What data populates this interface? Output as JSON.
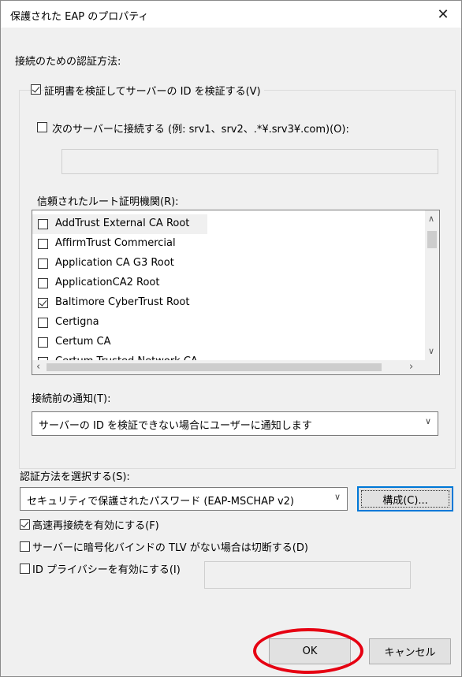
{
  "dialog": {
    "title": "保護された EAP のプロパティ",
    "close_glyph": "✕"
  },
  "auth_section": {
    "heading": "接続のための認証方法:",
    "verify_cert": {
      "label": "証明書を検証してサーバーの ID を検証する(V)",
      "checked": true
    },
    "connect_servers": {
      "label": "次のサーバーに接続する (例: srv1、srv2、.*¥.srv3¥.com)(O):",
      "checked": false,
      "value": ""
    },
    "trusted_root_label": "信頼されたルート証明機関(R):",
    "trusted_roots": [
      {
        "name": "AddTrust External CA Root",
        "checked": false
      },
      {
        "name": "AffirmTrust Commercial",
        "checked": false
      },
      {
        "name": "Application CA G3 Root",
        "checked": false
      },
      {
        "name": "ApplicationCA2 Root",
        "checked": false
      },
      {
        "name": "Baltimore CyberTrust Root",
        "checked": true
      },
      {
        "name": "Certigna",
        "checked": false
      },
      {
        "name": "Certum CA",
        "checked": false
      },
      {
        "name": "Certum Trusted Network CA",
        "checked": false
      }
    ],
    "notify_label": "接続前の通知(T):",
    "notify_value": "サーバーの ID を検証できない場合にユーザーに通知します"
  },
  "method_section": {
    "label": "認証方法を選択する(S):",
    "value": "セキュリティで保護されたパスワード (EAP-MSCHAP v2)",
    "configure_button": "構成(C)..."
  },
  "options": [
    {
      "label": "高速再接続を有効にする(F)",
      "checked": true
    },
    {
      "label": "サーバーに暗号化バインドの TLV がない場合は切断する(D)",
      "checked": false
    },
    {
      "label": "ID プライバシーを有効にする(I)",
      "checked": false
    }
  ],
  "footer": {
    "ok": "OK",
    "cancel": "キャンセル"
  },
  "colors": {
    "highlight_ring": "#e60012",
    "default_button_border": "#0078d7"
  }
}
